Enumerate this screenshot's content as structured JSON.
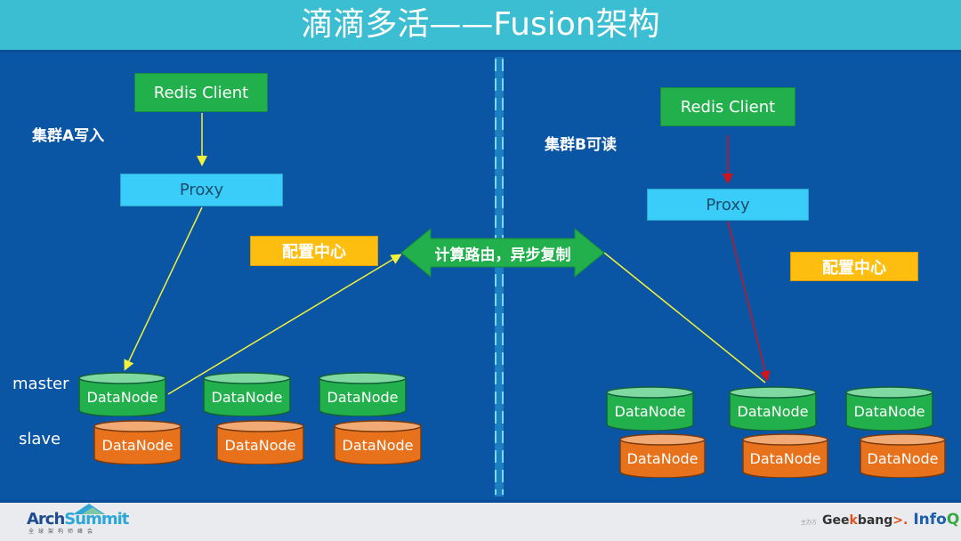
{
  "title": "滴滴多活——Fusion架构",
  "cluster_a": {
    "label": "集群A写入",
    "redis_client": "Redis Client",
    "proxy": "Proxy",
    "config_center": "配置中心",
    "row_labels": {
      "master": "master",
      "slave": "slave"
    },
    "master_nodes": [
      "DataNode",
      "DataNode",
      "DataNode"
    ],
    "slave_nodes": [
      "DataNode",
      "DataNode",
      "DataNode"
    ]
  },
  "cluster_b": {
    "label": "集群B可读",
    "redis_client": "Redis Client",
    "proxy": "Proxy",
    "config_center": "配置中心",
    "master_nodes": [
      "DataNode",
      "DataNode",
      "DataNode"
    ],
    "slave_nodes": [
      "DataNode",
      "DataNode",
      "DataNode"
    ]
  },
  "sync_arrow": {
    "label": "计算路由，异步复制"
  },
  "footer": {
    "left_logo": {
      "part1": "Arch",
      "part2": "Summit",
      "subtitle": "全球架构师峰会"
    },
    "right_logo": {
      "sponsor": "主办方",
      "geek1": "Gee",
      "geek_k": "k",
      "geek2": "bang",
      "geek_arrow": ">.",
      "infoq1": "Info",
      "infoq_q": "Q"
    }
  },
  "colors": {
    "title_bar": "#3bbdd2",
    "background": "#0b55a5",
    "client_green": "#21b04b",
    "proxy_cyan": "#3bcdfa",
    "config_yellow": "#fdbe10",
    "master_green": "#21b04b",
    "slave_orange": "#e8711c",
    "write_arrow": "#f2f23a",
    "read_arrow": "#d0121b"
  }
}
